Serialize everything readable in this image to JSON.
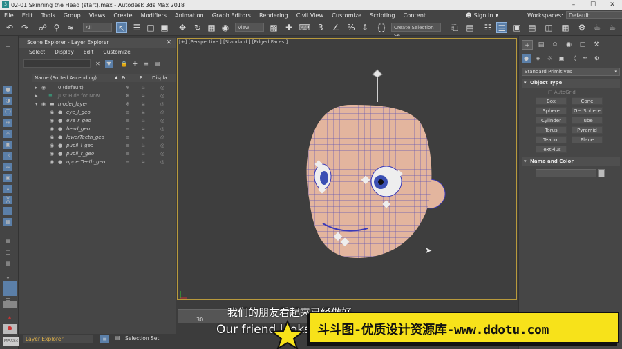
{
  "window": {
    "title": "02-01 Skinning the Head (start).max - Autodesk 3ds Max 2018",
    "app_icon": "3ds-max-logo",
    "controls": [
      "–",
      "☐",
      "✕"
    ]
  },
  "menu": {
    "items": [
      "File",
      "Edit",
      "Tools",
      "Group",
      "Views",
      "Create",
      "Modifiers",
      "Animation",
      "Graph Editors",
      "Rendering",
      "Civil View",
      "Customize",
      "Scripting",
      "Content"
    ],
    "sign_in": "Sign In",
    "workspaces_label": "Workspaces:",
    "workspaces_value": "Default"
  },
  "toolbar": {
    "selection_filter": "All",
    "ref_coord": "View",
    "named_selection": "Create Selection Se"
  },
  "scene_explorer": {
    "title": "Scene Explorer - Layer Explorer",
    "menu": [
      "Select",
      "Display",
      "Edit",
      "Customize"
    ],
    "columns": [
      "Name (Sorted Ascending)",
      "Fr...",
      "R...",
      "Displa..."
    ],
    "rows": [
      {
        "name": "0 (default)",
        "kind": "layer"
      },
      {
        "name": "Just Hide for Now",
        "kind": "hidden-layer"
      },
      {
        "name": "model_layer",
        "kind": "layer"
      },
      {
        "name": "eye_l_geo",
        "kind": "object"
      },
      {
        "name": "eye_r_geo",
        "kind": "object"
      },
      {
        "name": "head_geo",
        "kind": "object"
      },
      {
        "name": "lowerTeeth_geo",
        "kind": "object"
      },
      {
        "name": "pupil_l_geo",
        "kind": "object"
      },
      {
        "name": "pupil_r_geo",
        "kind": "object"
      },
      {
        "name": "upperTeeth_geo",
        "kind": "object"
      }
    ]
  },
  "viewport": {
    "label": "[+] [Perspective ] [Standard ] [Edged Faces ]"
  },
  "timeline": {
    "frame_tick": "30"
  },
  "status": {
    "explorer_select": "Layer Explorer",
    "selection_set_label": "Selection Set:",
    "maxscript": "MAXSc"
  },
  "command_panel": {
    "category_dropdown": "Standard Primitives",
    "object_type_title": "Object Type",
    "autogrid": "AutoGrid",
    "objects": [
      "Box",
      "Cone",
      "Sphere",
      "GeoSphere",
      "Cylinder",
      "Tube",
      "Torus",
      "Pyramid",
      "Teapot",
      "Plane",
      "TextPlus"
    ],
    "name_color_title": "Name and Color"
  },
  "overlay": {
    "subtitle_zh": "我们的朋友看起来已经做好",
    "subtitle_en": "Our friend looks",
    "watermark": "斗斗图-优质设计资源库-www.ddotu.com"
  },
  "colors": {
    "accent": "#5b7fa8",
    "viewport_border": "#b89a3c",
    "watermark_bg": "#f7e21a",
    "skin": "#e3b59e",
    "wire": "#3b3ab8"
  }
}
